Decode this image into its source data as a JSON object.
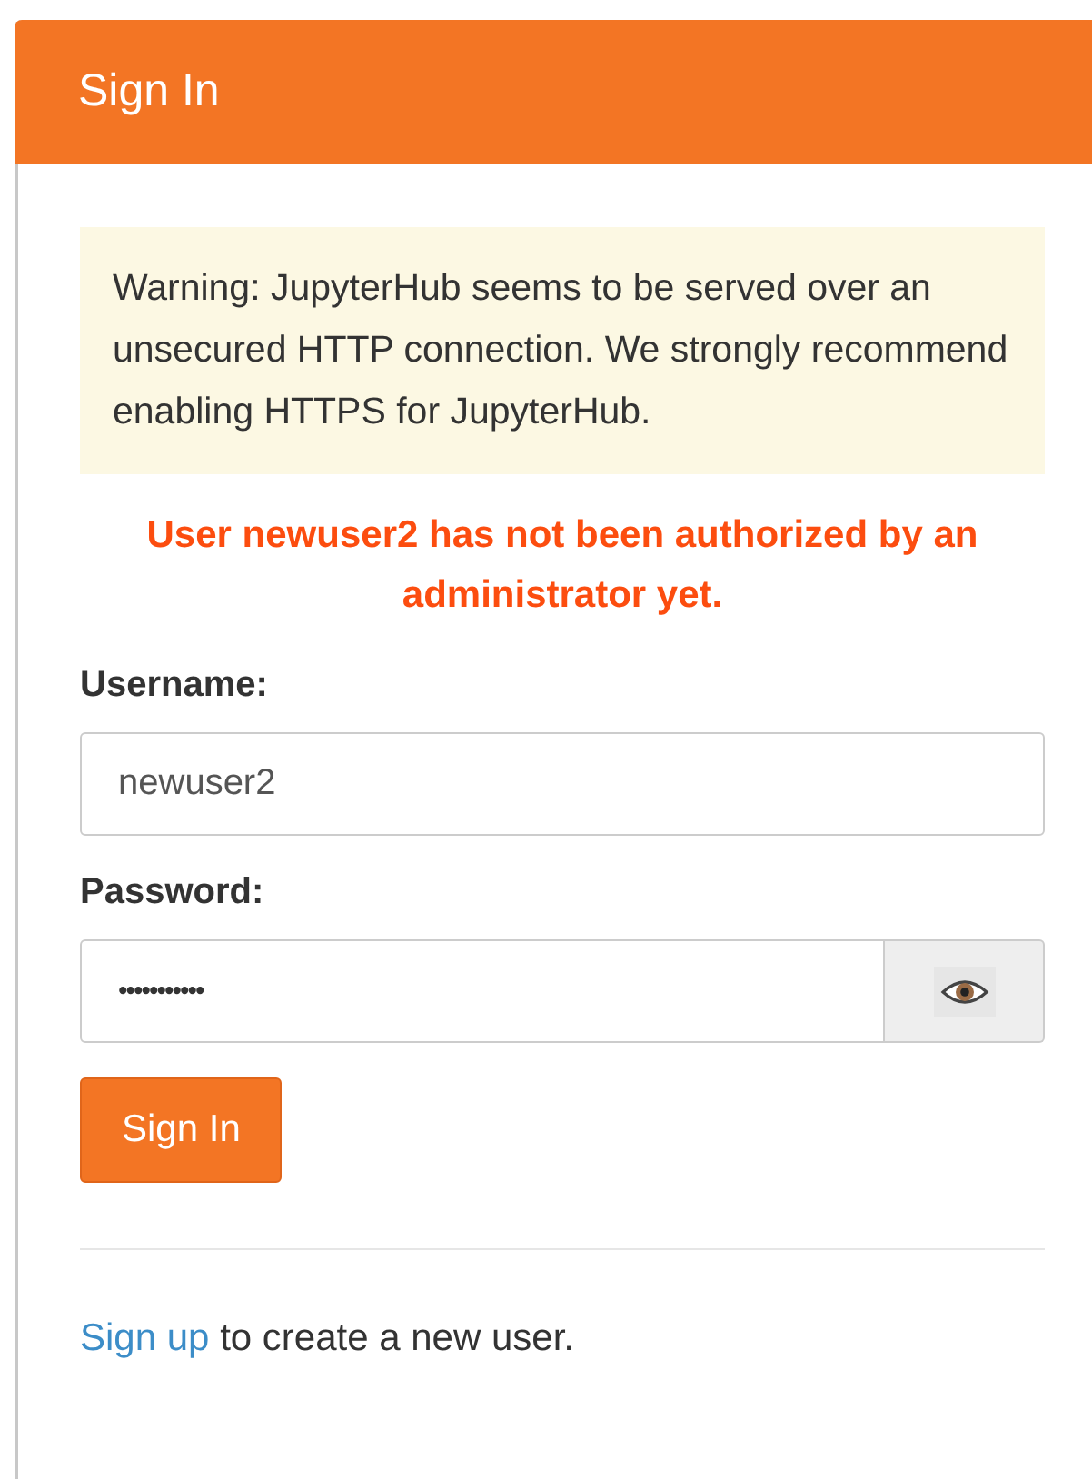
{
  "panel": {
    "title": "Sign In"
  },
  "warning": "Warning: JupyterHub seems to be served over an unsecured HTTP connection. We strongly recommend enabling HTTPS for JupyterHub.",
  "error": "User newuser2 has not been authorized by an administrator yet.",
  "username": {
    "label": "Username:",
    "value": "newuser2"
  },
  "password": {
    "label": "Password:",
    "value": "•••••••••••"
  },
  "submit": "Sign In",
  "footer": {
    "link": "Sign up",
    "text": " to create a new user."
  }
}
